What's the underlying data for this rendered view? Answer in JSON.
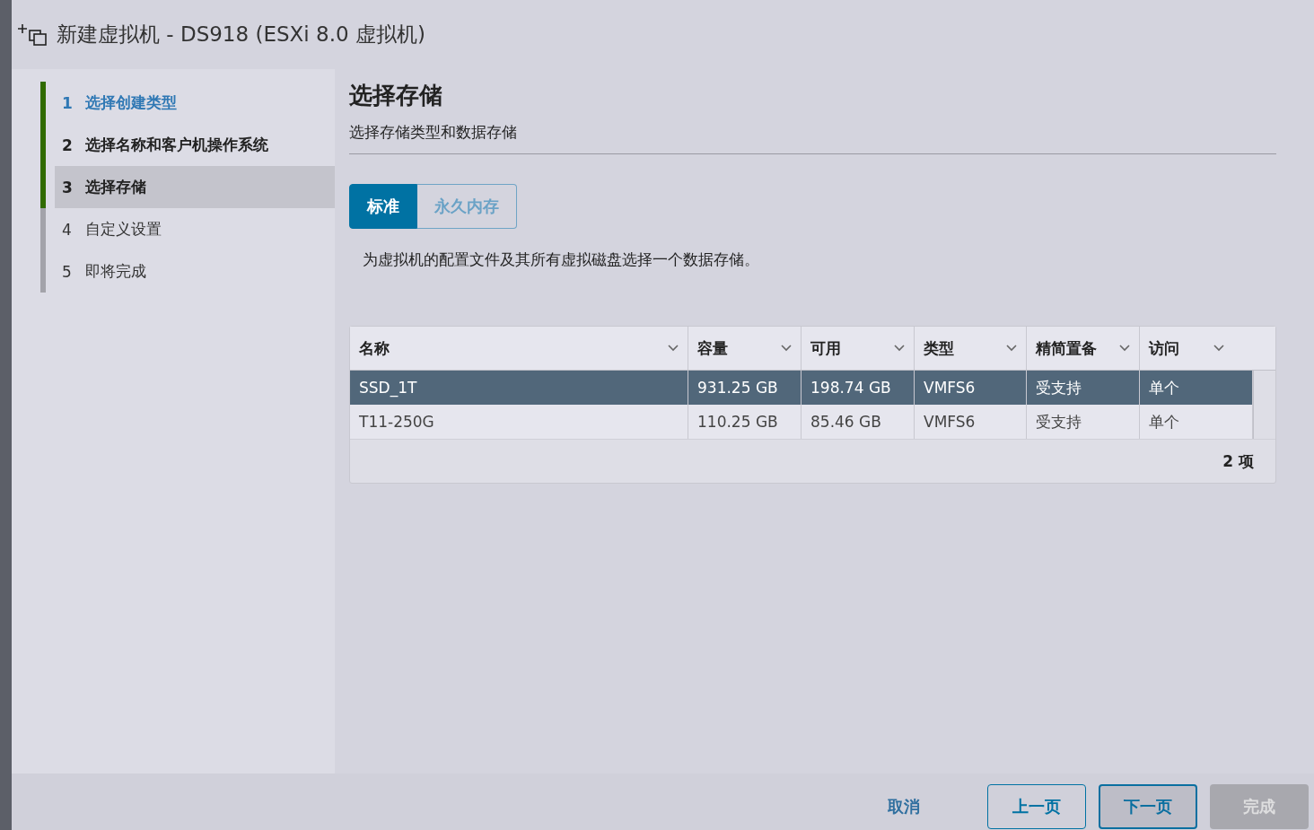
{
  "window": {
    "title": "新建虚拟机 - DS918 (ESXi 8.0 虚拟机)"
  },
  "steps": [
    {
      "number": "1",
      "label": "选择创建类型",
      "kind": "link",
      "selected": false,
      "completed": true
    },
    {
      "number": "2",
      "label": "选择名称和客户机操作系统",
      "kind": "visited",
      "selected": false,
      "completed": true
    },
    {
      "number": "3",
      "label": "选择存储",
      "kind": "visited",
      "selected": true,
      "completed": true
    },
    {
      "number": "4",
      "label": "自定义设置",
      "kind": "pending",
      "selected": false,
      "completed": false
    },
    {
      "number": "5",
      "label": "即将完成",
      "kind": "pending",
      "selected": false,
      "completed": false
    }
  ],
  "page": {
    "heading": "选择存储",
    "subheading": "选择存储类型和数据存储"
  },
  "tabs": [
    {
      "label": "标准",
      "selected": true
    },
    {
      "label": "永久内存",
      "selected": false
    }
  ],
  "description": "为虚拟机的配置文件及其所有虚拟磁盘选择一个数据存储。",
  "table": {
    "columns": [
      "名称",
      "容量",
      "可用",
      "类型",
      "精简置备",
      "访问"
    ],
    "rows": [
      {
        "cells": [
          "SSD_1T",
          "931.25 GB",
          "198.74 GB",
          "VMFS6",
          "受支持",
          "单个"
        ],
        "selected": true
      },
      {
        "cells": [
          "T11-250G",
          "110.25 GB",
          "85.46 GB",
          "VMFS6",
          "受支持",
          "单个"
        ],
        "selected": false
      }
    ],
    "footer": "2 项"
  },
  "buttons": [
    {
      "label": "取消",
      "kind": "link"
    },
    {
      "label": "上一页",
      "kind": "outline"
    },
    {
      "label": "下一页",
      "kind": "focused"
    },
    {
      "label": "完成",
      "kind": "disabled"
    }
  ]
}
